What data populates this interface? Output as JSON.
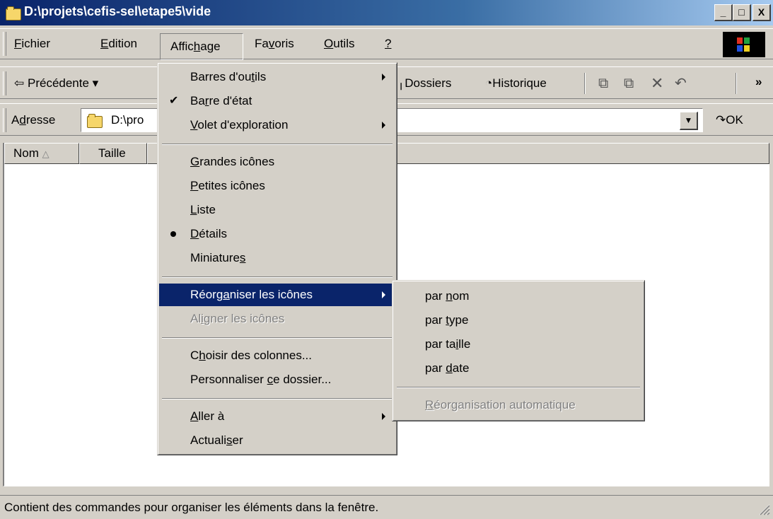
{
  "window": {
    "title": "D:\\projets\\cefis-sel\\etape5\\vide",
    "min": "_",
    "max": "□",
    "close": "X"
  },
  "menubar": {
    "items": [
      {
        "pre": "",
        "u": "F",
        "post": "ichier"
      },
      {
        "pre": "",
        "u": "E",
        "post": "dition"
      },
      {
        "pre": "Affic",
        "u": "h",
        "post": "age"
      },
      {
        "pre": "Fa",
        "u": "v",
        "post": "oris"
      },
      {
        "pre": "",
        "u": "O",
        "post": "utils"
      },
      {
        "pre": "",
        "u": "?",
        "post": ""
      }
    ]
  },
  "toolbar": {
    "back": "Précédente",
    "folders": "Dossiers",
    "history": "Historique",
    "more": "»"
  },
  "address": {
    "label_pre": "A",
    "label_u": "d",
    "label_post": "resse",
    "value": "D:\\pro",
    "go": "OK"
  },
  "columns": {
    "name": "Nom",
    "size": "Taille",
    "sort_indicator": "△"
  },
  "view_menu": {
    "toolbars": {
      "pre": "Barres d'ou",
      "u": "t",
      "post": "ils"
    },
    "statusbar": {
      "pre": "Ba",
      "u": "r",
      "post": "re d'état"
    },
    "explorer": {
      "pre": "",
      "u": "V",
      "post": "olet d'exploration"
    },
    "large": {
      "pre": "",
      "u": "G",
      "post": "randes icônes"
    },
    "small": {
      "pre": "",
      "u": "P",
      "post": "etites icônes"
    },
    "list": {
      "pre": "",
      "u": "L",
      "post": "iste"
    },
    "details": {
      "pre": "",
      "u": "D",
      "post": "étails"
    },
    "thumbs": {
      "pre": "Miniature",
      "u": "s",
      "post": ""
    },
    "arrange": {
      "pre": "Réorg",
      "u": "a",
      "post": "niser les icônes"
    },
    "align": {
      "pre": "Al",
      "u": "i",
      "post": "gner les icônes"
    },
    "choose_cols": {
      "pre": "C",
      "u": "h",
      "post": "oisir des colonnes..."
    },
    "customize": {
      "pre": "Personnaliser ",
      "u": "c",
      "post": "e dossier..."
    },
    "goto": {
      "pre": "",
      "u": "A",
      "post": "ller à"
    },
    "refresh": {
      "pre": "Actuali",
      "u": "s",
      "post": "er"
    },
    "check_mark": "✔"
  },
  "arrange_menu": {
    "by_name": {
      "pre": "par ",
      "u": "n",
      "post": "om"
    },
    "by_type": {
      "pre": "par ",
      "u": "t",
      "post": "ype"
    },
    "by_size": {
      "pre": "par ta",
      "u": "i",
      "post": "lle"
    },
    "by_date": {
      "pre": "par ",
      "u": "d",
      "post": "ate"
    },
    "auto": {
      "pre": "",
      "u": "R",
      "post": "éorganisation automatique"
    }
  },
  "status": {
    "text": "Contient des commandes pour organiser les éléments dans la fenêtre."
  },
  "colors": {
    "title_start": "#0a246a",
    "title_end": "#a6caf0",
    "highlight": "#0a246a",
    "face": "#d4d0c8"
  }
}
